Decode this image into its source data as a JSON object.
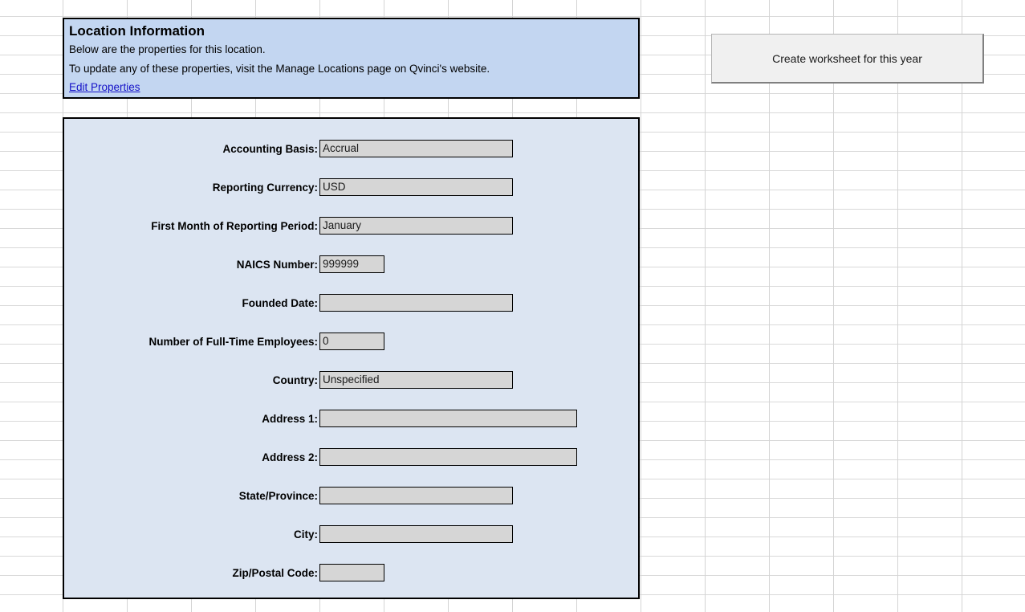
{
  "header": {
    "title": "Location Information",
    "line1": "Below are the properties for this location.",
    "line2": "To update any of these properties, visit the Manage Locations page on Qvinci's website.",
    "edit_link": "Edit Properties"
  },
  "toolbar": {
    "create_worksheet_label": "Create worksheet for this year"
  },
  "properties": [
    {
      "label": "Accounting Basis:",
      "value": "Accrual",
      "size": "w-lg"
    },
    {
      "label": "Reporting Currency:",
      "value": "USD",
      "size": "w-lg"
    },
    {
      "label": "First Month of Reporting Period:",
      "value": "January",
      "size": "w-lg"
    },
    {
      "label": "NAICS Number:",
      "value": "999999",
      "size": "w-sm"
    },
    {
      "label": "Founded Date:",
      "value": "",
      "size": "w-lg"
    },
    {
      "label": "Number of Full-Time Employees:",
      "value": "0",
      "size": "w-sm"
    },
    {
      "label": "Country:",
      "value": "Unspecified",
      "size": "w-lg"
    },
    {
      "label": "Address 1:",
      "value": "",
      "size": "w-xl"
    },
    {
      "label": "Address 2:",
      "value": "",
      "size": "w-xl"
    },
    {
      "label": "State/Province:",
      "value": "",
      "size": "w-lg"
    },
    {
      "label": "City:",
      "value": "",
      "size": "w-lg"
    },
    {
      "label": "Zip/Postal Code:",
      "value": "",
      "size": "w-sm"
    }
  ],
  "colors": {
    "header_panel": "#c3d6f1",
    "props_panel": "#dce5f2",
    "field_box": "#d6d6d6",
    "link": "#1411c8",
    "button": "#f0f0f0"
  }
}
